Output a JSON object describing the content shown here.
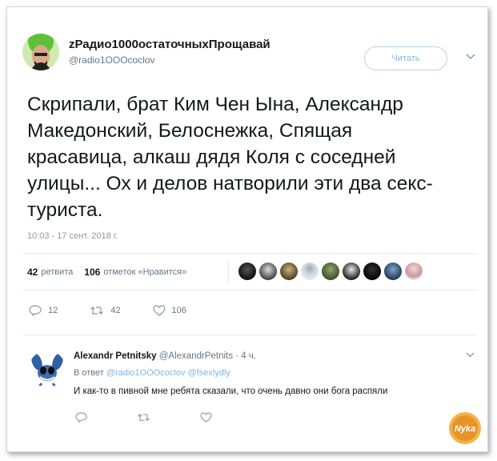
{
  "tweet": {
    "display_name": "zРадио1000остаточныхПрощавай",
    "username": "@radio1OOOcoclov",
    "follow_label": "Читать",
    "text": "Скрипали, брат Ким Чен Ына, Александр Македонский, Белоснежка, Спящая красавица, алкаш дядя Коля с соседней улицы... Ох и делов натворили эти два секс-туриста.",
    "text_lines": [
      "Скрипали, брат Ким Чен Ына, Александр",
      "Македонский, Белоснежка, Спящая",
      "красавица, алкаш дядя Коля с соседней",
      "улицы... Ох и делов натворили эти два секс-",
      "туриста."
    ],
    "timestamp": "10:03 - 17 сент. 2018 г.",
    "retweets_count": "42",
    "retweets_label": "ретвита",
    "likes_count": "106",
    "likes_label": "отметок «Нравится»",
    "action_counts": {
      "reply": "12",
      "retweet": "42",
      "like": "106"
    }
  },
  "reply": {
    "display_name": "Alexandr Petnitsky",
    "username": "@AlexandrPetnits",
    "time": "· 4 ч.",
    "in_reply_prefix": "В ответ",
    "in_reply_users": [
      "@radio1OOOcoclov",
      "@fsexlydly"
    ],
    "text": "И как-то в пивной мне ребята сказали, что очень давно они бога распяли"
  },
  "watermark": {
    "text": "Nyka"
  },
  "colors": {
    "link": "#7eb7e3",
    "muted": "#657786",
    "text": "#14171a",
    "watermark": "#f0a030"
  },
  "icons": [
    "chevron-down-icon",
    "reply-icon",
    "retweet-icon",
    "heart-icon"
  ]
}
